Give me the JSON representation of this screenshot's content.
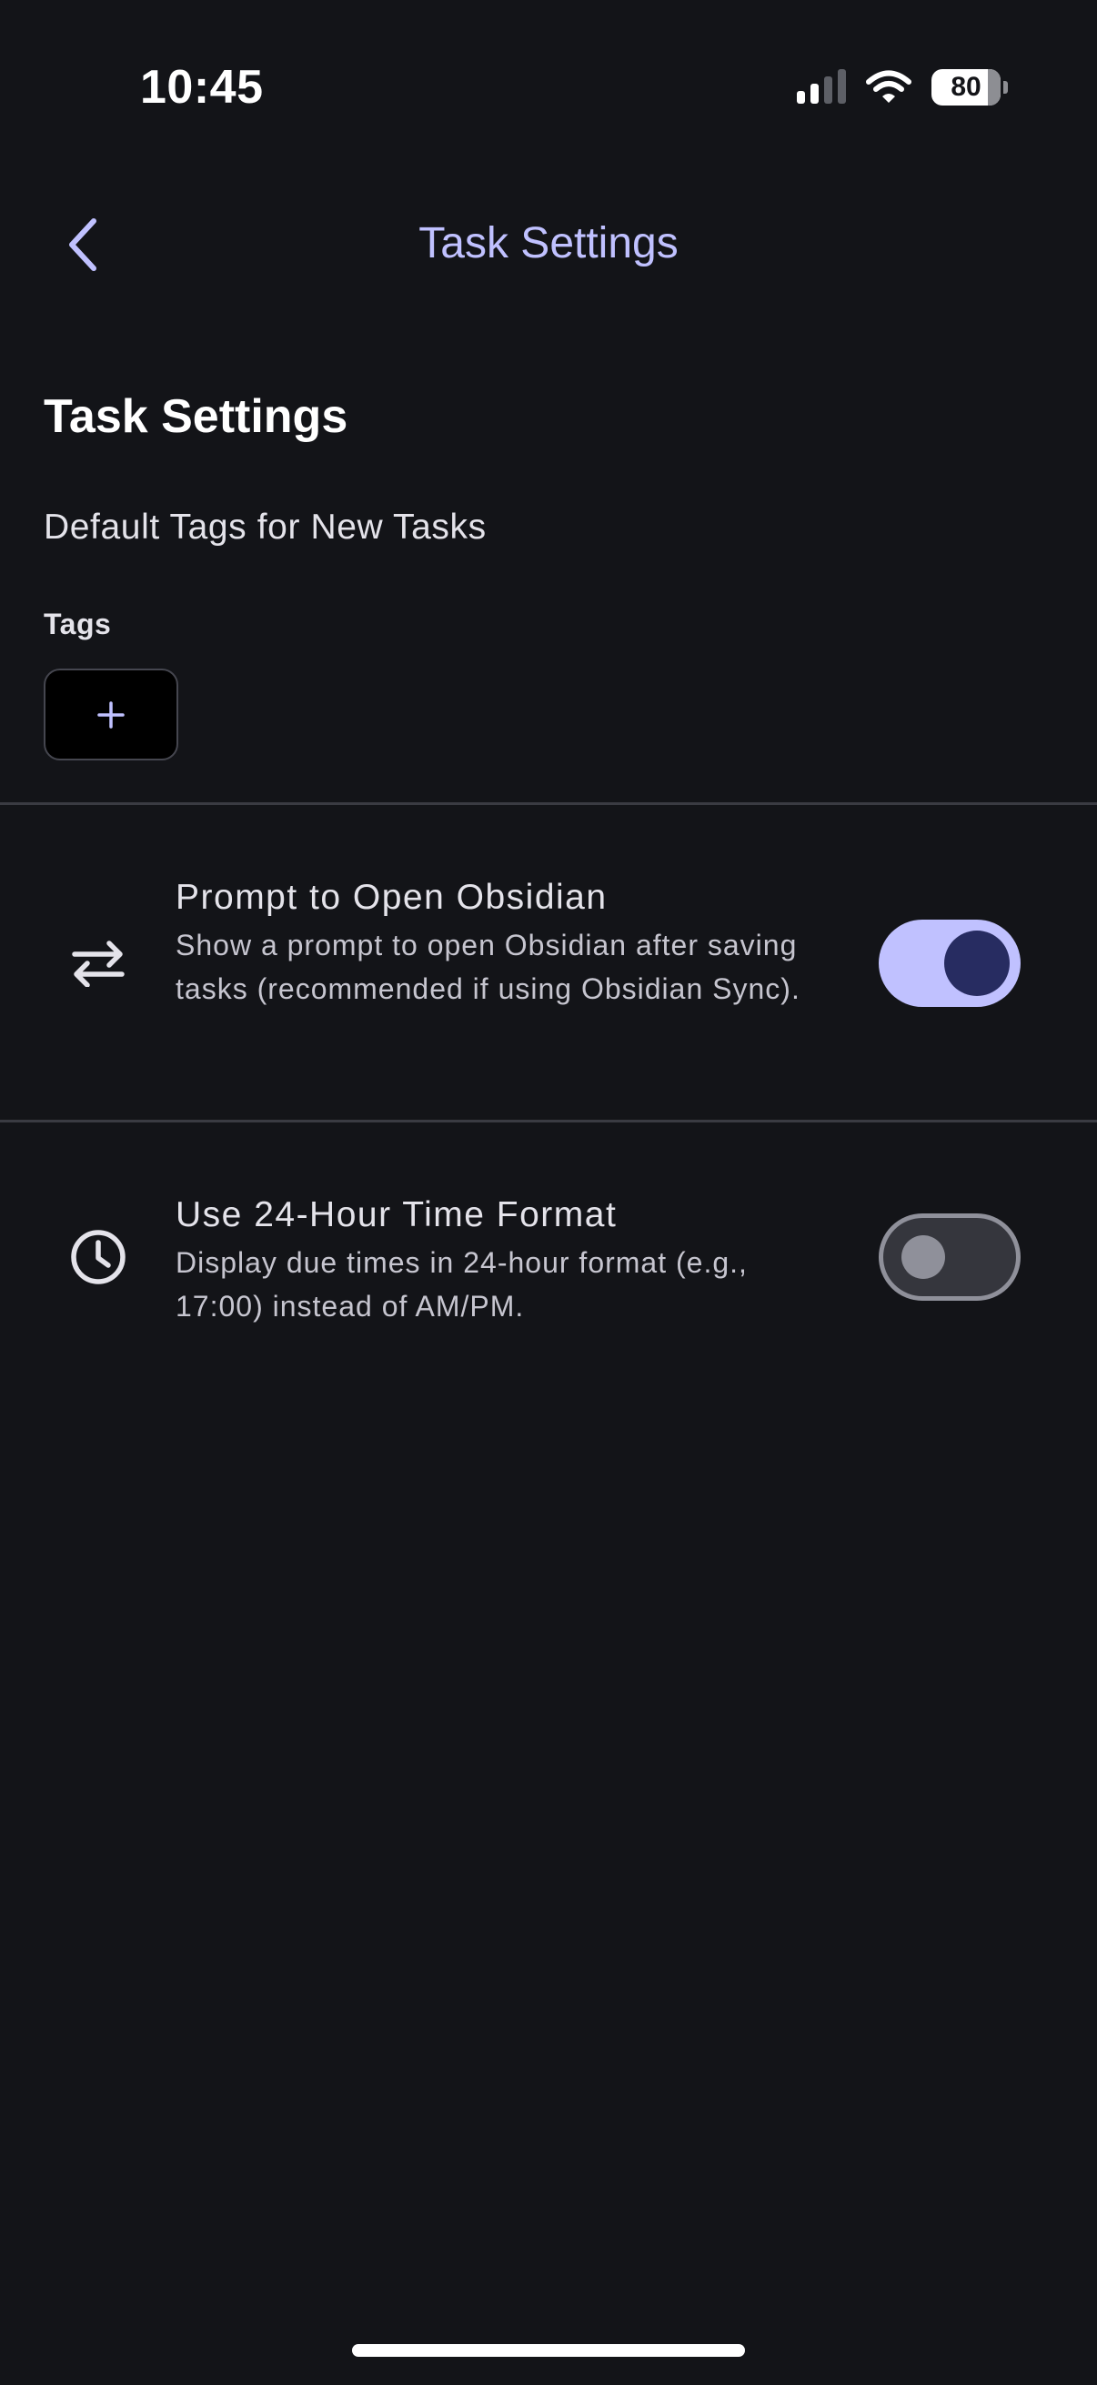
{
  "status_bar": {
    "time": "10:45",
    "battery": "80",
    "icons": [
      "signal-icon",
      "wifi-icon",
      "battery-icon"
    ]
  },
  "header": {
    "title": "Task Settings",
    "back_icon": "chevron-left-icon"
  },
  "main": {
    "title": "Task Settings",
    "default_tags_title": "Default Tags for New Tasks",
    "tags_label": "Tags",
    "add_tag_icon": "plus-icon"
  },
  "settings": [
    {
      "icon": "swap-arrows-icon",
      "title": "Prompt to Open Obsidian",
      "description": "Show a prompt to open Obsidian after saving tasks (recommended if using Obsidian Sync).",
      "enabled": true
    },
    {
      "icon": "clock-icon",
      "title": "Use 24-Hour Time Format",
      "description": "Display due times in 24-hour format (e.g., 17:00) instead of AM/PM.",
      "enabled": false
    }
  ],
  "colors": {
    "background": "#131418",
    "accent": "#c0c1ff",
    "toggle_knob_on": "#272c61",
    "toggle_off_track": "#35363d",
    "toggle_off_border": "#8f909a",
    "text_primary": "#e4e3ea",
    "text_secondary": "#c6c5cf"
  }
}
